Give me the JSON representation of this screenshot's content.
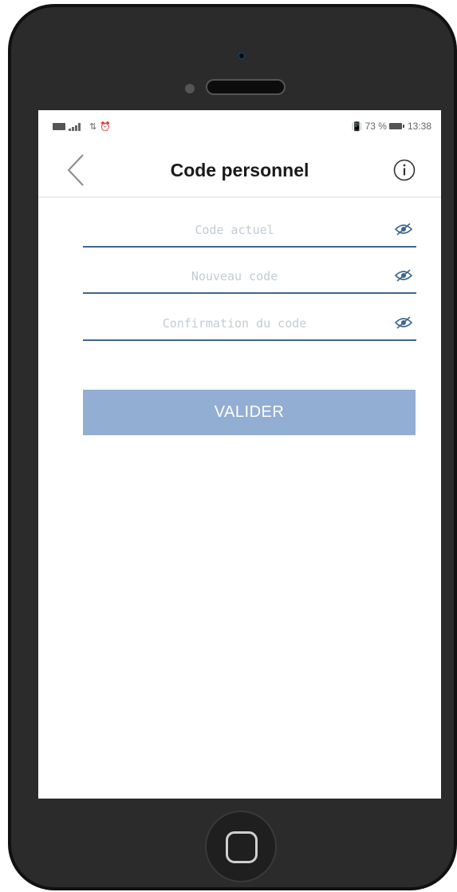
{
  "status_bar": {
    "battery_percent": "73 %",
    "time": "13:38"
  },
  "header": {
    "title": "Code personnel",
    "back_icon": "chevron-left-icon",
    "info_icon": "info-icon"
  },
  "form": {
    "fields": [
      {
        "placeholder": "Code actuel",
        "value": "",
        "toggle_icon": "eye-slash-icon"
      },
      {
        "placeholder": "Nouveau code",
        "value": "",
        "toggle_icon": "eye-slash-icon"
      },
      {
        "placeholder": "Confirmation du code",
        "value": "",
        "toggle_icon": "eye-slash-icon"
      }
    ],
    "submit_label": "VALIDER"
  },
  "colors": {
    "accent": "#3f6790",
    "button_disabled": "#93aed3",
    "placeholder": "#c3cbd4"
  }
}
